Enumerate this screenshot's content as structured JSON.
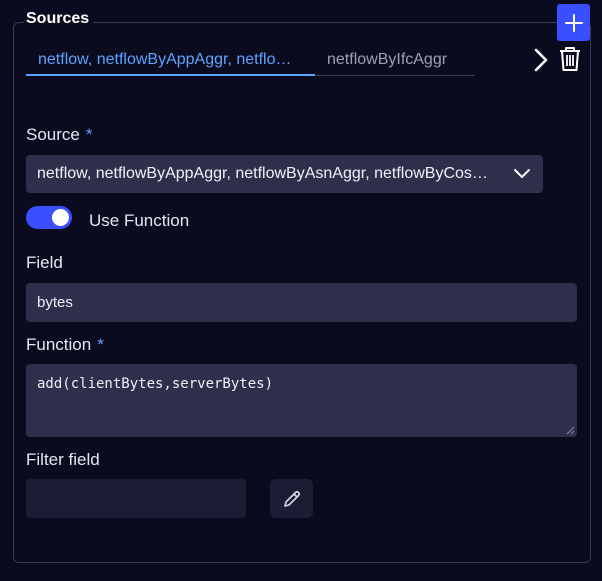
{
  "panel": {
    "legend": "Sources"
  },
  "tabs": [
    {
      "label": "netflow, netflowByAppAggr, netflowByAsnAggr, netflowByCosAggr",
      "active": true
    },
    {
      "label": "netflowByIfcAggr",
      "active": false
    }
  ],
  "source": {
    "label": "Source",
    "required_mark": "*",
    "value": "netflow, netflowByAppAggr, netflowByAsnAggr, netflowByCosAggr, netflowByIfcAggr"
  },
  "use_function": {
    "label": "Use Function",
    "enabled": true
  },
  "field": {
    "label": "Field",
    "value": "bytes"
  },
  "function": {
    "label": "Function",
    "required_mark": "*",
    "value": "add(clientBytes,serverBytes)"
  },
  "filter_field": {
    "label": "Filter field",
    "value": ""
  },
  "icons": {
    "add": "plus-icon",
    "next": "chevron-right-icon",
    "delete": "trash-icon",
    "dropdown": "chevron-down-icon",
    "edit": "pencil-icon"
  },
  "colors": {
    "background": "#0b0b1f",
    "accent": "#3a4fff",
    "active_tab": "#5ea2ff",
    "input_bg": "#2d2f4b"
  }
}
